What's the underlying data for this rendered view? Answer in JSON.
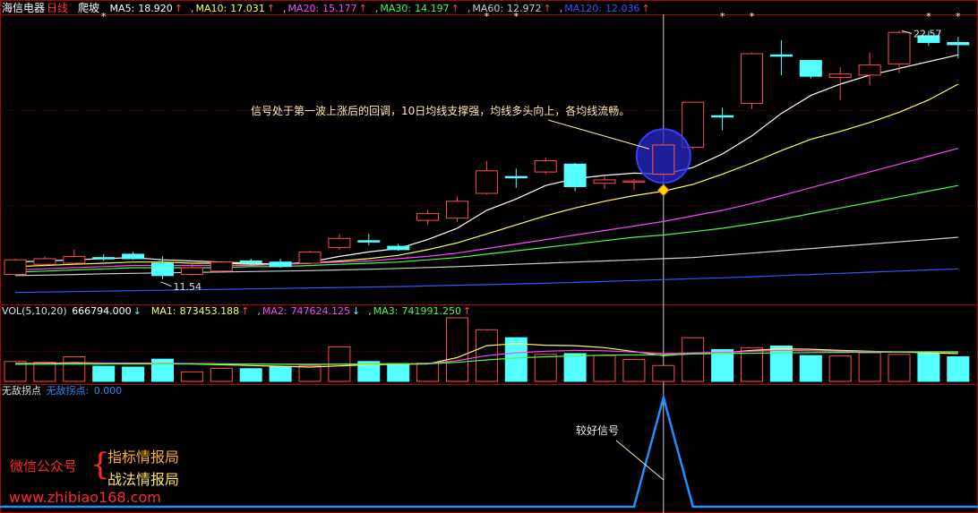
{
  "header": {
    "stock_name": "海信电器",
    "period": "日线",
    "pattern": "爬坡",
    "ma": [
      {
        "label": "MA5:",
        "value": "18.920",
        "arrow": "↑",
        "color": "#ffffff"
      },
      {
        "label": "MA10:",
        "value": "17.031",
        "arrow": "↑",
        "color": "#ffff55"
      },
      {
        "label": "MA20:",
        "value": "15.177",
        "arrow": "↑",
        "color": "#ff44ff"
      },
      {
        "label": "MA30:",
        "value": "14.197",
        "arrow": "↑",
        "color": "#44ff44"
      },
      {
        "label": "MA60:",
        "value": "12.972",
        "arrow": "↑",
        "color": "#cfcfcf"
      },
      {
        "label": "MA120:",
        "value": "12.036",
        "arrow": "↑",
        "color": "#3355ff"
      }
    ]
  },
  "volume_header": {
    "label": "VOL(5,10,20)",
    "value": "666794.000",
    "value_arrow": "↓",
    "ma": [
      {
        "label": "MA1:",
        "value": "873453.188",
        "arrow": "↑",
        "color": "#ffff55"
      },
      {
        "label": "MA2:",
        "value": "747624.125",
        "arrow": "↓",
        "color": "#ff44ff"
      },
      {
        "label": "MA3:",
        "value": "741991.250",
        "arrow": "↑",
        "color": "#44ff44"
      }
    ]
  },
  "indicator_header": {
    "name": "无敌拐点",
    "series_label": "无敌拐点:",
    "series_value": "0.000"
  },
  "annotations": {
    "main_note": "信号处于第一波上涨后的回调，10日均线支撑强，均线多头向上，各均线流畅。",
    "signal_note": "较好信号",
    "high_label": "22.57",
    "low_label": "11.54"
  },
  "watermark": {
    "label": "微信公众号",
    "brace": "{",
    "line1": "指标情报局",
    "line2": "战法情报局",
    "url": "www.zhibiao168.com"
  },
  "colors": {
    "up": "#ff4d4d",
    "down": "#54ffff",
    "grid": "#7a0000",
    "signal_line": "#1e90ff"
  },
  "chart_data": [
    {
      "type": "candlestick",
      "title": "",
      "ylim": [
        10.5,
        23.3
      ],
      "candles": [
        {
          "o": 11.75,
          "c": 12.4,
          "h": 12.45,
          "l": 11.7
        },
        {
          "o": 12.2,
          "c": 12.45,
          "h": 12.55,
          "l": 12.1
        },
        {
          "o": 12.25,
          "c": 12.55,
          "h": 12.85,
          "l": 12.2
        },
        {
          "o": 12.5,
          "c": 12.45,
          "h": 12.65,
          "l": 12.35
        },
        {
          "o": 12.65,
          "c": 12.45,
          "h": 12.75,
          "l": 12.4
        },
        {
          "o": 12.25,
          "c": 11.7,
          "h": 12.55,
          "l": 11.54
        },
        {
          "o": 11.75,
          "c": 12.05,
          "h": 12.2,
          "l": 11.7
        },
        {
          "o": 11.9,
          "c": 12.3,
          "h": 12.35,
          "l": 11.85
        },
        {
          "o": 12.35,
          "c": 12.25,
          "h": 12.45,
          "l": 12.15
        },
        {
          "o": 12.3,
          "c": 12.1,
          "h": 12.45,
          "l": 12.05
        },
        {
          "o": 12.25,
          "c": 12.75,
          "h": 12.8,
          "l": 12.2
        },
        {
          "o": 12.95,
          "c": 13.35,
          "h": 13.55,
          "l": 12.85
        },
        {
          "o": 13.25,
          "c": 13.2,
          "h": 13.55,
          "l": 13.05
        },
        {
          "o": 13.0,
          "c": 12.85,
          "h": 13.1,
          "l": 12.8
        },
        {
          "o": 14.15,
          "c": 14.45,
          "h": 14.6,
          "l": 13.95
        },
        {
          "o": 14.25,
          "c": 15.0,
          "h": 15.2,
          "l": 14.1
        },
        {
          "o": 15.35,
          "c": 16.35,
          "h": 16.8,
          "l": 15.3
        },
        {
          "o": 16.1,
          "c": 16.05,
          "h": 16.45,
          "l": 15.6
        },
        {
          "o": 16.3,
          "c": 16.8,
          "h": 16.95,
          "l": 16.2
        },
        {
          "o": 16.65,
          "c": 15.65,
          "h": 16.7,
          "l": 15.45
        },
        {
          "o": 15.8,
          "c": 15.95,
          "h": 16.1,
          "l": 15.55
        },
        {
          "o": 15.85,
          "c": 15.9,
          "h": 16.0,
          "l": 15.5
        },
        {
          "o": 16.2,
          "c": 17.5,
          "h": 17.7,
          "l": 16.05
        },
        {
          "o": 17.4,
          "c": 19.4,
          "h": 19.4,
          "l": 17.3
        },
        {
          "o": 18.8,
          "c": 18.75,
          "h": 19.15,
          "l": 18.15
        },
        {
          "o": 19.35,
          "c": 21.55,
          "h": 21.6,
          "l": 19.1
        },
        {
          "o": 21.5,
          "c": 21.45,
          "h": 22.15,
          "l": 20.6
        },
        {
          "o": 21.25,
          "c": 20.55,
          "h": 21.25,
          "l": 20.45
        },
        {
          "o": 20.5,
          "c": 20.65,
          "h": 20.95,
          "l": 19.5
        },
        {
          "o": 20.6,
          "c": 21.05,
          "h": 21.6,
          "l": 20.15
        },
        {
          "o": 21.1,
          "c": 22.5,
          "h": 22.57,
          "l": 20.7
        },
        {
          "o": 22.35,
          "c": 22.05,
          "h": 22.57,
          "l": 21.9
        },
        {
          "o": 22.05,
          "c": 21.95,
          "h": 22.3,
          "l": 21.35
        }
      ],
      "ma_series": [
        {
          "name": "MA5",
          "color": "#ffffff",
          "values": [
            12.3,
            12.35,
            12.4,
            12.45,
            12.5,
            12.4,
            12.35,
            12.3,
            12.25,
            12.2,
            12.3,
            12.55,
            12.75,
            12.9,
            13.3,
            13.8,
            14.6,
            15.1,
            15.7,
            16.0,
            16.15,
            16.25,
            16.2,
            16.5,
            17.1,
            17.9,
            18.9,
            19.7,
            20.2,
            20.6,
            20.9,
            21.2,
            21.5
          ]
        },
        {
          "name": "MA10",
          "color": "#ffff55",
          "values": [
            12.1,
            12.15,
            12.2,
            12.25,
            12.3,
            12.3,
            12.25,
            12.25,
            12.2,
            12.2,
            12.25,
            12.35,
            12.45,
            12.6,
            12.85,
            13.15,
            13.55,
            13.95,
            14.35,
            14.7,
            15.0,
            15.25,
            15.45,
            15.75,
            16.2,
            16.7,
            17.25,
            17.75,
            18.1,
            18.5,
            18.95,
            19.5,
            20.2
          ]
        },
        {
          "name": "MA20",
          "color": "#ff44ff",
          "values": [
            11.95,
            12.0,
            12.05,
            12.1,
            12.15,
            12.15,
            12.15,
            12.15,
            12.15,
            12.2,
            12.25,
            12.3,
            12.35,
            12.45,
            12.55,
            12.7,
            12.9,
            13.1,
            13.3,
            13.5,
            13.7,
            13.9,
            14.1,
            14.35,
            14.6,
            14.9,
            15.25,
            15.6,
            15.95,
            16.3,
            16.65,
            17.0,
            17.35
          ]
        },
        {
          "name": "MA30",
          "color": "#44ff44",
          "values": [
            11.85,
            11.9,
            11.95,
            12.0,
            12.05,
            12.05,
            12.05,
            12.05,
            12.1,
            12.1,
            12.15,
            12.2,
            12.25,
            12.3,
            12.4,
            12.5,
            12.65,
            12.8,
            12.95,
            13.1,
            13.25,
            13.4,
            13.5,
            13.65,
            13.8,
            14.0,
            14.2,
            14.45,
            14.7,
            14.95,
            15.2,
            15.45,
            15.7
          ]
        },
        {
          "name": "MA60",
          "color": "#cfcfcf",
          "values": [
            11.7,
            11.72,
            11.75,
            11.78,
            11.8,
            11.82,
            11.84,
            11.86,
            11.88,
            11.9,
            11.92,
            11.95,
            11.98,
            12.02,
            12.06,
            12.1,
            12.15,
            12.2,
            12.25,
            12.3,
            12.35,
            12.4,
            12.45,
            12.5,
            12.6,
            12.7,
            12.8,
            12.9,
            13.0,
            13.1,
            13.2,
            13.3,
            13.4
          ]
        },
        {
          "name": "MA120",
          "color": "#3355ff",
          "values": [
            10.95,
            10.97,
            10.99,
            11.01,
            11.03,
            11.05,
            11.07,
            11.09,
            11.11,
            11.13,
            11.15,
            11.17,
            11.19,
            11.21,
            11.24,
            11.27,
            11.3,
            11.33,
            11.36,
            11.4,
            11.44,
            11.48,
            11.52,
            11.56,
            11.6,
            11.65,
            11.7,
            11.75,
            11.8,
            11.85,
            11.9,
            11.95,
            12.0
          ]
        }
      ],
      "star_candles": [
        3,
        16,
        17,
        24,
        25,
        31,
        32
      ]
    },
    {
      "type": "bar",
      "title": "VOL(5,10,20)",
      "ylim": [
        0,
        1600000
      ],
      "values": [
        500000,
        480000,
        620000,
        380000,
        360000,
        560000,
        240000,
        330000,
        320000,
        370000,
        400000,
        870000,
        500000,
        450000,
        460000,
        1600000,
        1300000,
        1100000,
        680000,
        700000,
        650000,
        550000,
        400000,
        1100000,
        800000,
        850000,
        890000,
        650000,
        640000,
        720000,
        680000,
        700000,
        620000
      ],
      "ma_series": [
        {
          "name": "MA1",
          "color": "#ffff55",
          "values": [
            450000,
            455000,
            470000,
            460000,
            460000,
            460000,
            440000,
            420000,
            400000,
            380000,
            360000,
            390000,
            420000,
            430000,
            440000,
            600000,
            900000,
            950000,
            910000,
            900000,
            850000,
            750000,
            650000,
            700000,
            720000,
            780000,
            820000,
            810000,
            780000,
            760000,
            740000,
            720000,
            700000
          ]
        },
        {
          "name": "MA2",
          "color": "#ff44ff",
          "values": [
            440000,
            445000,
            450000,
            452000,
            455000,
            455000,
            450000,
            445000,
            440000,
            430000,
            420000,
            430000,
            440000,
            445000,
            450000,
            520000,
            650000,
            720000,
            760000,
            780000,
            770000,
            740000,
            700000,
            720000,
            730000,
            760000,
            780000,
            770000,
            760000,
            750000,
            748000,
            747000,
            747624
          ]
        },
        {
          "name": "MA3",
          "color": "#44ff44",
          "values": [
            430000,
            432000,
            435000,
            437000,
            440000,
            440000,
            440000,
            438000,
            436000,
            434000,
            432000,
            436000,
            440000,
            442000,
            444000,
            480000,
            540000,
            590000,
            620000,
            640000,
            660000,
            670000,
            670000,
            690000,
            700000,
            710000,
            720000,
            725000,
            730000,
            735000,
            738000,
            740000,
            741991
          ]
        }
      ]
    },
    {
      "type": "line",
      "title": "无敌拐点",
      "ylim": [
        0,
        1
      ],
      "values": [
        0,
        0,
        0,
        0,
        0,
        0,
        0,
        0,
        0,
        0,
        0,
        0,
        0,
        0,
        0,
        0,
        0,
        0,
        0,
        0,
        0,
        0,
        1,
        0,
        0,
        0,
        0,
        0,
        0,
        0,
        0,
        0,
        0
      ]
    }
  ]
}
